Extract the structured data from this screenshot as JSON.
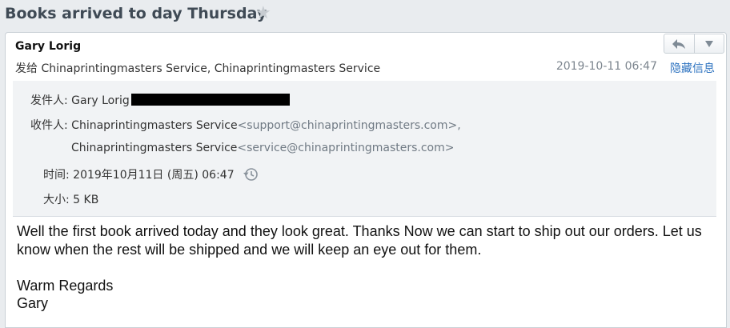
{
  "subject": "Books arrived to day Thursday",
  "star_icon": "star-icon",
  "header": {
    "sender_name": "Gary Lorig",
    "to_prefix": "发给",
    "to_summary": "Chinaprintingmasters Service, Chinaprintingmasters Service",
    "date_short": "2019-10-11 06:47",
    "hide_details_label": "隐藏信息",
    "buttons": [
      "reply-icon",
      "more-dropdown-icon"
    ]
  },
  "details": {
    "from_label": "发件人:",
    "from_name": "Gary Lorig",
    "to_label": "收件人:",
    "recipients": [
      {
        "name": "Chinaprintingmasters Service",
        "email": "<support@chinaprintingmasters.com>,"
      },
      {
        "name": "Chinaprintingmasters Service",
        "email": "<service@chinaprintingmasters.com>"
      }
    ],
    "time_label": "时间:",
    "time_value": "2019年10月11日 (周五) 06:47",
    "size_label": "大小:",
    "size_value": "5 KB"
  },
  "body": {
    "paragraph1": "Well the first book arrived today and they look great. Thanks Now we can start to ship out our orders. Let us know when the rest will be shipped and we will keep an eye out for them.",
    "closing": "Warm Regards",
    "signature": "Gary"
  },
  "colors": {
    "link": "#2e73c0",
    "background": "#e9ecef",
    "details_bg": "#f1f3f5"
  }
}
